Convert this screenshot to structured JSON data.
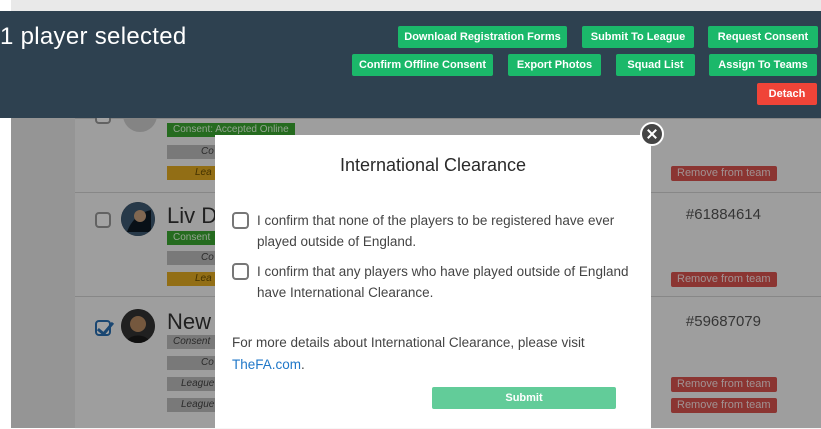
{
  "toolbar": {
    "title": "1 player selected",
    "buttons": {
      "download_forms": "Download Registration Forms",
      "submit_league": "Submit To League",
      "request_consent": "Request Consent",
      "confirm_offline": "Confirm Offline Consent",
      "export_photos": "Export Photos",
      "squad_list": "Squad List",
      "assign_teams": "Assign To Teams",
      "detach": "Detach"
    }
  },
  "players": [
    {
      "name": "",
      "id": "",
      "tags": [
        "Consent: Accepted Online",
        "Co",
        "Lea"
      ],
      "remove_label": "Remove from team"
    },
    {
      "name": "Liv Da",
      "id": "#61884614",
      "tags": [
        "Consent",
        "Co",
        "Lea"
      ],
      "remove_label": "Remove from team"
    },
    {
      "name": "New C",
      "id": "#59687079",
      "tags": [
        "Consent",
        "Co",
        "League",
        "League"
      ],
      "remove_labels": [
        "Remove from team",
        "Remove from team"
      ]
    }
  ],
  "modal": {
    "title": "International Clearance",
    "option1": "I confirm that none of the players to be registered have ever played outside of England.",
    "option2": "I confirm that any players who have played outside of England have International Clearance.",
    "details_text": "For more details about International Clearance, please visit",
    "link_text": "TheFA.com",
    "link_suffix": ".",
    "submit_label": "Submit"
  }
}
